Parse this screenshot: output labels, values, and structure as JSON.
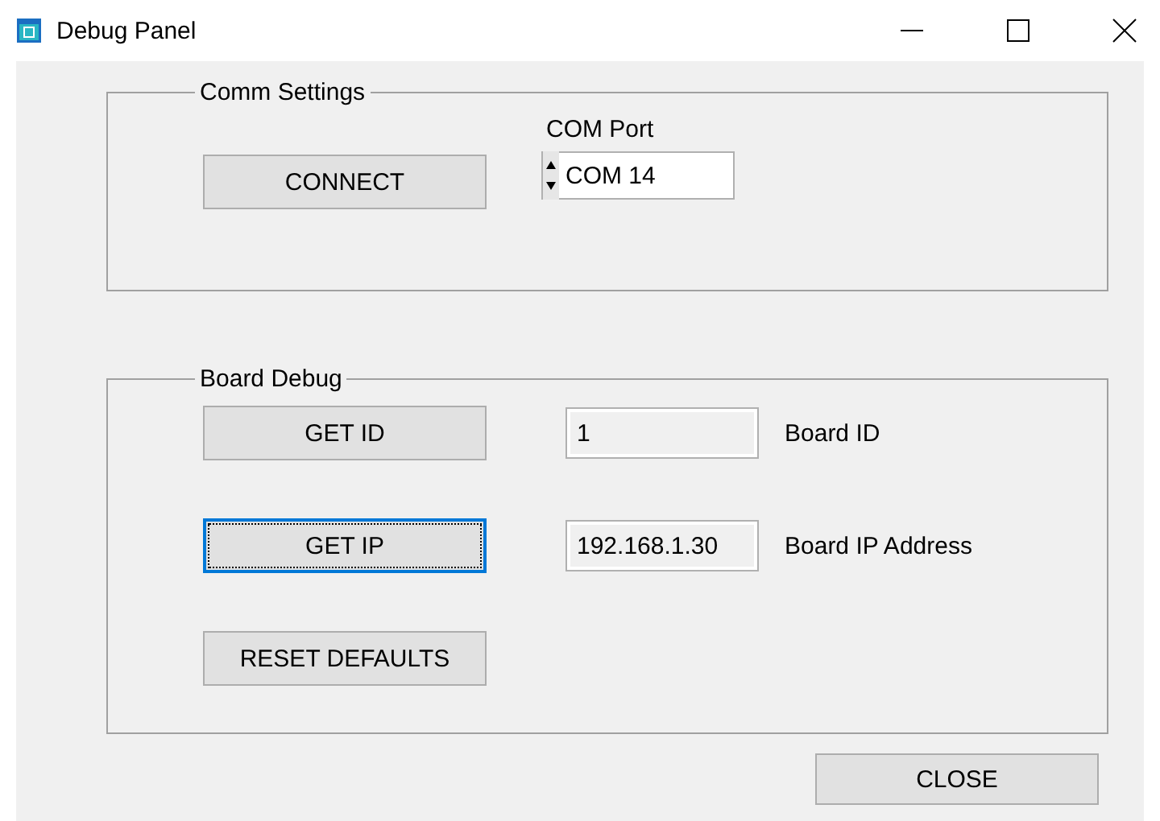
{
  "window": {
    "title": "Debug Panel"
  },
  "comm_settings": {
    "title": "Comm Settings",
    "connect_button": "CONNECT",
    "com_port": {
      "label": "COM Port",
      "value": "COM 14"
    }
  },
  "board_debug": {
    "title": "Board Debug",
    "rows": [
      {
        "button": "GET ID",
        "focused": false,
        "value": "1",
        "label": "Board ID"
      },
      {
        "button": "GET IP",
        "focused": true,
        "value": "192.168.1.30",
        "label": "Board IP Address"
      },
      {
        "button": "RESET DEFAULTS",
        "focused": false
      }
    ]
  },
  "close_button": "CLOSE"
}
